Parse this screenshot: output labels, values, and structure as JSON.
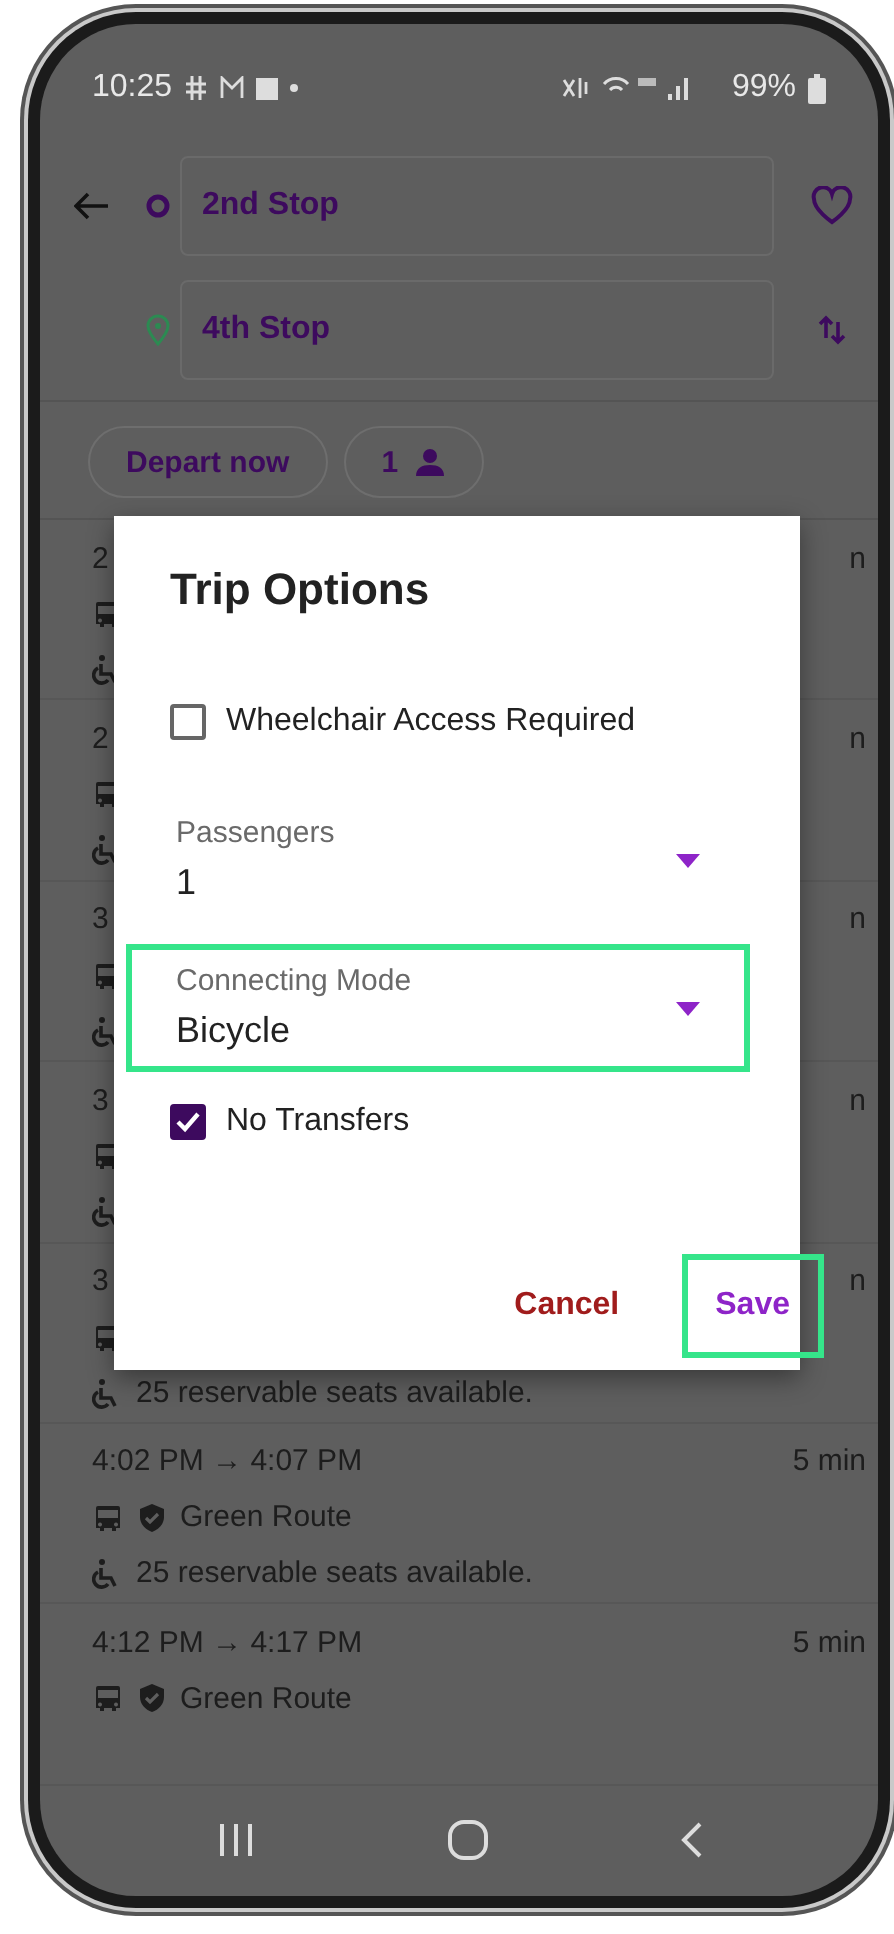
{
  "status_bar": {
    "time": "10:25",
    "battery": "99%"
  },
  "header": {
    "origin": "2nd Stop",
    "destination": "4th Stop"
  },
  "chips": [
    {
      "label": "Depart now",
      "kind": "text"
    },
    {
      "label": "1",
      "kind": "passengers"
    }
  ],
  "trips": [
    {
      "kind": "covered",
      "time": "2",
      "duration": "n"
    },
    {
      "kind": "covered",
      "time": "2",
      "duration": "n"
    },
    {
      "kind": "covered",
      "time": "3",
      "duration": "n"
    },
    {
      "kind": "covered",
      "time": "3",
      "duration": "n"
    },
    {
      "kind": "covered",
      "time": "3",
      "duration": "n",
      "seats": "25 reservable seats available."
    },
    {
      "kind": "full",
      "time": "4:02 PM → 4:07 PM",
      "duration": "5 min",
      "route": "Green Route",
      "seats": "25 reservable seats available."
    },
    {
      "kind": "full",
      "time": "4:12 PM → 4:17 PM",
      "duration": "5 min",
      "route": "Green Route"
    }
  ],
  "dialog": {
    "title": "Trip Options",
    "options": [
      {
        "kind": "checkbox",
        "label": "Wheelchair Access Required",
        "checked": false
      },
      {
        "kind": "dropdown",
        "label": "Passengers",
        "value": "1",
        "highlighted": false
      },
      {
        "kind": "dropdown",
        "label": "Connecting Mode",
        "value": "Bicycle",
        "highlighted": true
      },
      {
        "kind": "checkbox",
        "label": "No Transfers",
        "checked": true
      }
    ],
    "buttons": [
      {
        "label": "Cancel",
        "kind": "cancel",
        "highlighted": false
      },
      {
        "label": "Save",
        "kind": "confirm",
        "highlighted": true
      }
    ]
  }
}
